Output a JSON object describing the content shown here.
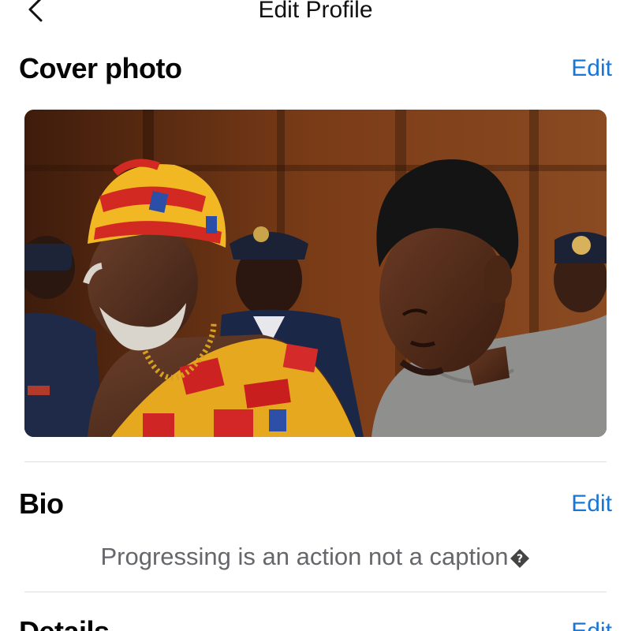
{
  "header": {
    "title": "Edit Profile",
    "back_icon": "chevron-left-icon"
  },
  "cover_section": {
    "title": "Cover photo",
    "edit_label": "Edit"
  },
  "bio_section": {
    "title": "Bio",
    "edit_label": "Edit",
    "text": "Progressing is an action not a caption",
    "trailing_glyph_icon": "unknown-character-icon"
  },
  "details_section": {
    "title": "Details",
    "edit_label": "Edit"
  },
  "colors": {
    "accent": "#1877d6",
    "secondary_text": "#65676b",
    "divider": "#dcdde0"
  }
}
